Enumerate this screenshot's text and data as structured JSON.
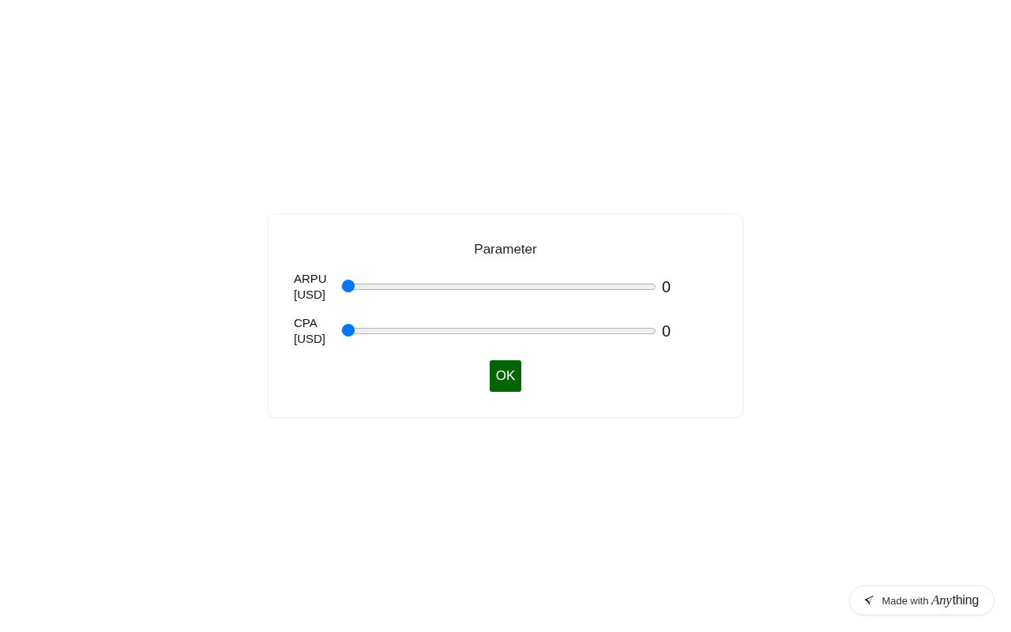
{
  "dialog": {
    "title": "Parameter",
    "parameters": [
      {
        "label": "ARPU [USD]",
        "level": 0,
        "value": "0"
      },
      {
        "label": "CPA [USD]",
        "level": 0,
        "value": "0"
      }
    ],
    "button": "OK"
  },
  "badge": {
    "prefix": "Made with",
    "brand_parts": [
      {
        "text": "Any",
        "italic": true
      },
      {
        "text": "thing",
        "italic": false
      }
    ]
  }
}
